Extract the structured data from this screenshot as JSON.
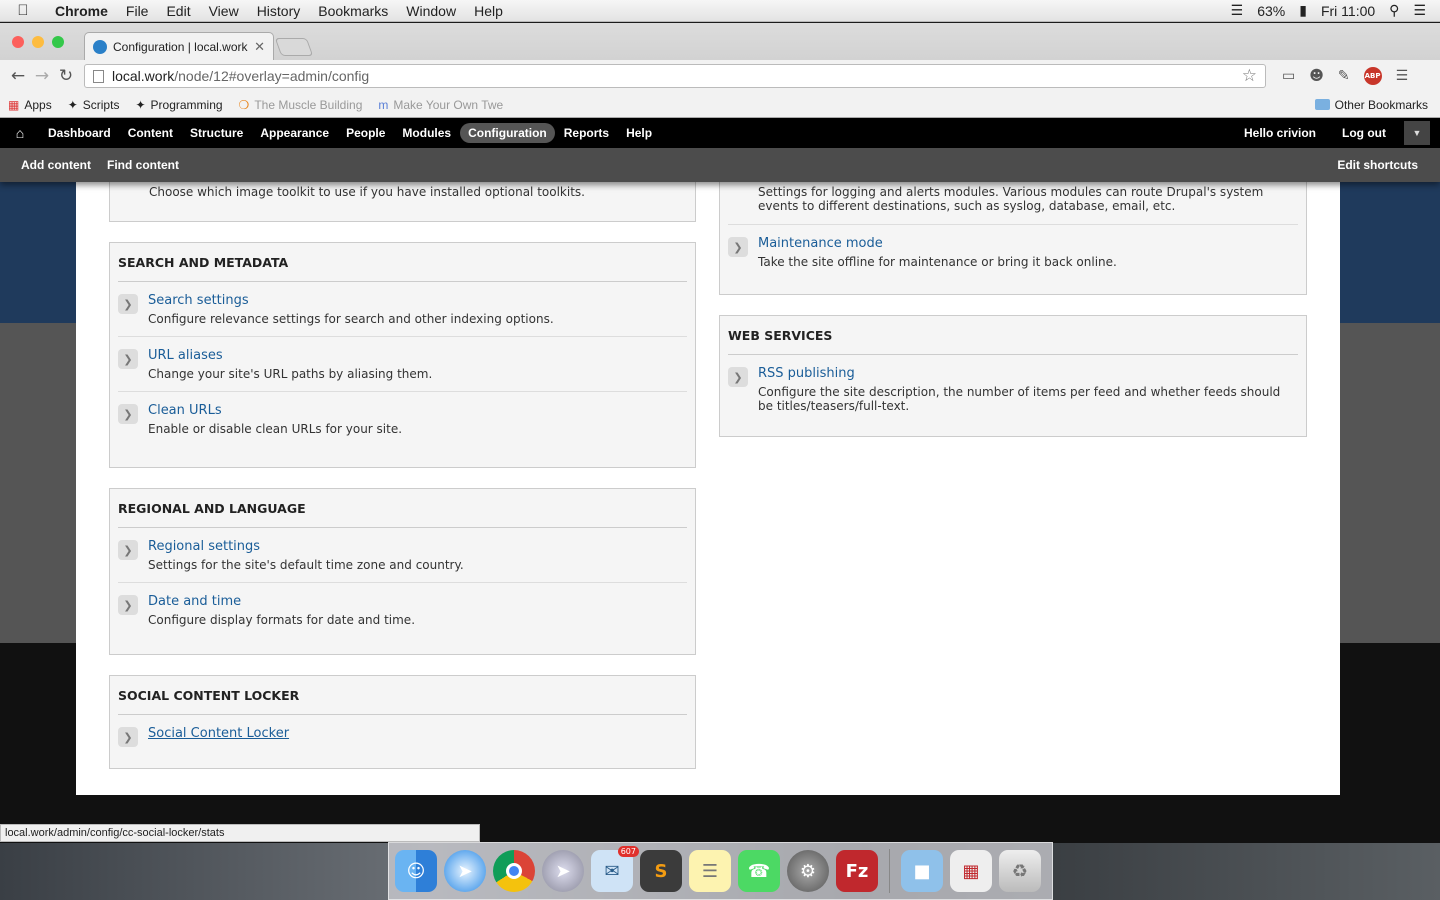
{
  "menubar": {
    "app": "Chrome",
    "items": [
      "File",
      "Edit",
      "View",
      "History",
      "Bookmarks",
      "Window",
      "Help"
    ],
    "battery": "63%",
    "clock": "Fri 11:00"
  },
  "browser": {
    "tab_title": "Configuration | local.work",
    "url_host": "local.work",
    "url_path": "/node/12#overlay=admin/config",
    "bookmarks": [
      "Apps",
      "Scripts",
      "Programming",
      "The Muscle Building",
      "Make Your Own Twe"
    ],
    "other_bookmarks": "Other Bookmarks",
    "abp_label": "ABP"
  },
  "drupal_toolbar": {
    "items": [
      "Dashboard",
      "Content",
      "Structure",
      "Appearance",
      "People",
      "Modules",
      "Configuration",
      "Reports",
      "Help"
    ],
    "active": "Configuration",
    "greeting": "Hello ",
    "username": "crivion",
    "logout": "Log out"
  },
  "shortcuts": {
    "items": [
      "Add content",
      "Find content"
    ],
    "edit": "Edit shortcuts"
  },
  "left_column": {
    "partial_desc": "Choose which image toolkit to use if you have installed optional toolkits.",
    "search": {
      "title": "SEARCH AND METADATA",
      "entries": [
        {
          "link": "Search settings",
          "desc": "Configure relevance settings for search and other indexing options."
        },
        {
          "link": "URL aliases",
          "desc": "Change your site's URL paths by aliasing them."
        },
        {
          "link": "Clean URLs",
          "desc": "Enable or disable clean URLs for your site."
        }
      ]
    },
    "regional": {
      "title": "REGIONAL AND LANGUAGE",
      "entries": [
        {
          "link": "Regional settings",
          "desc": "Settings for the site's default time zone and country."
        },
        {
          "link": "Date and time",
          "desc": "Configure display formats for date and time."
        }
      ]
    },
    "social": {
      "title": "SOCIAL CONTENT LOCKER",
      "entries": [
        {
          "link": "Social Content Locker",
          "desc": ""
        }
      ]
    }
  },
  "right_column": {
    "partial_desc": "Settings for logging and alerts modules. Various modules can route Drupal's system events to different destinations, such as syslog, database, email, etc.",
    "maintenance": {
      "link": "Maintenance mode",
      "desc": "Take the site offline for maintenance or bring it back online."
    },
    "web": {
      "title": "WEB SERVICES",
      "entries": [
        {
          "link": "RSS publishing",
          "desc": "Configure the site description, the number of items per feed and whether feeds should be titles/teasers/full-text."
        }
      ]
    }
  },
  "status_url": "local.work/admin/config/cc-social-locker/stats",
  "dock": {
    "mail_badge": "607",
    "apps": [
      "Finder",
      "Safari",
      "Chrome",
      "Launchpad",
      "Mail",
      "Sublime Text",
      "Notes",
      "FaceTime",
      "System Preferences",
      "FileZilla",
      "Documents",
      "FileZilla Files",
      "Trash"
    ]
  }
}
